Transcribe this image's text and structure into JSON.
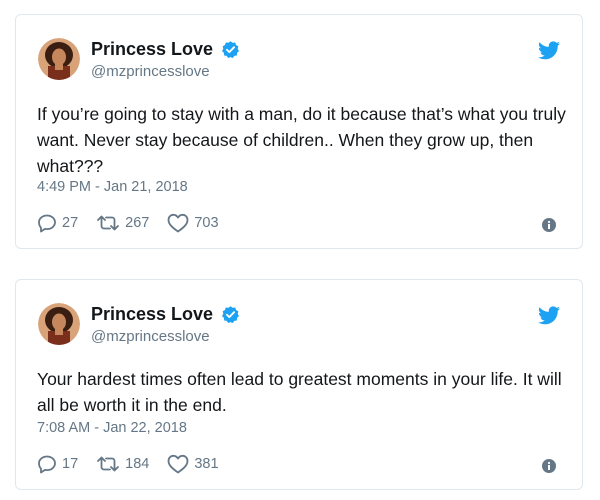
{
  "tweets": [
    {
      "author": "Princess Love",
      "handle": "@mzprincesslove",
      "text": "If you’re going to stay with a man, do it because that’s what you truly want. Never stay because of children.. When they grow up, then what???",
      "timestamp": "4:49 PM - Jan 21, 2018",
      "replies": "27",
      "retweets": "267",
      "likes": "703"
    },
    {
      "author": "Princess Love",
      "handle": "@mzprincesslove",
      "text": "Your hardest times often lead to greatest moments in your life. It will all be worth it in the end.",
      "timestamp": "7:08 AM - Jan 22, 2018",
      "replies": "17",
      "retweets": "184",
      "likes": "381"
    }
  ],
  "icons": {
    "verified": "verified-badge-icon",
    "brand": "twitter-bird-icon",
    "reply": "reply-icon",
    "retweet": "retweet-icon",
    "like": "heart-icon",
    "info": "info-icon"
  },
  "colors": {
    "twitter_blue": "#1da1f2",
    "secondary_text": "#657786",
    "primary_text": "#14171a",
    "border": "#e1e8ed"
  }
}
